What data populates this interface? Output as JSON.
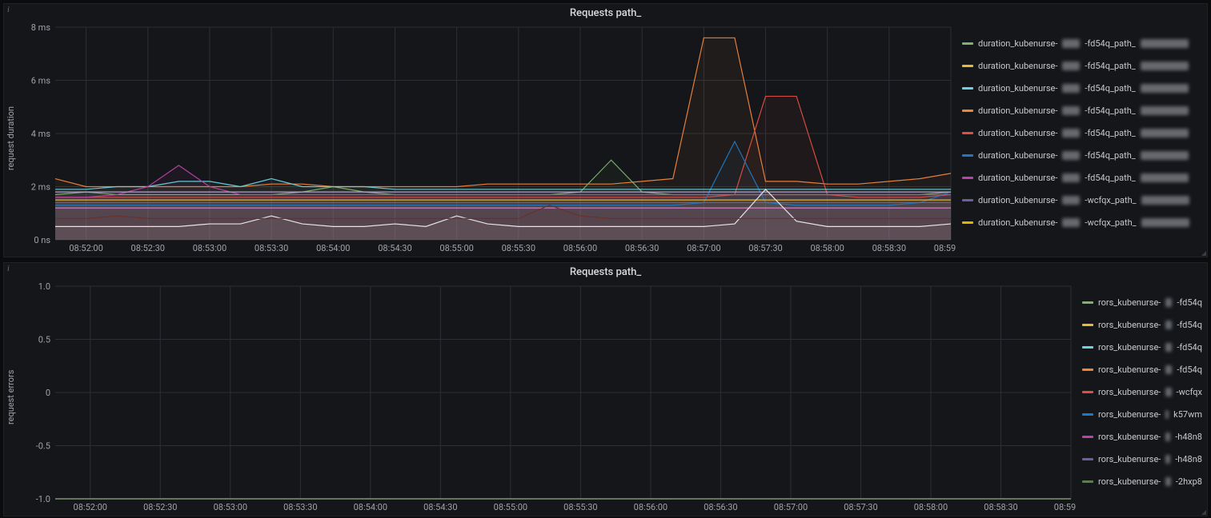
{
  "panel1": {
    "title": "Requests path_",
    "ylabel": "request duration",
    "legend_prefix": "duration_kubenurse-",
    "legend_suffix": "-fd54q_path_",
    "legend_rows": [
      {
        "color": "#7EB26D",
        "mid": "-fd54q_path_"
      },
      {
        "color": "#EAB839",
        "mid": "-fd54q_path_"
      },
      {
        "color": "#6ED0E0",
        "mid": "-fd54q_path_"
      },
      {
        "color": "#EF843C",
        "mid": "-fd54q_path_"
      },
      {
        "color": "#E24D42",
        "mid": "-fd54q_path_"
      },
      {
        "color": "#1F78C1",
        "mid": "-fd54q_path_"
      },
      {
        "color": "#BA43A9",
        "mid": "-fd54q_path_"
      },
      {
        "color": "#705DA0",
        "mid": "-wcfqx_path_"
      },
      {
        "color": "#E0B400",
        "mid": "-wcfqx_path_"
      }
    ]
  },
  "panel2": {
    "title": "Requests path_",
    "ylabel": "request errors",
    "legend_prefix": "rors_kubenurse-",
    "legend_rows": [
      {
        "color": "#7EB26D",
        "mid": "-fd54q"
      },
      {
        "color": "#EAB839",
        "mid": "-fd54q"
      },
      {
        "color": "#6ED0E0",
        "mid": "-fd54q"
      },
      {
        "color": "#EF843C",
        "mid": "-fd54q"
      },
      {
        "color": "#E24D42",
        "mid": "-wcfqx"
      },
      {
        "color": "#1F78C1",
        "mid": "k57wm"
      },
      {
        "color": "#BA43A9",
        "mid": "-h48n8"
      },
      {
        "color": "#705DA0",
        "mid": "-h48n8"
      },
      {
        "color": "#508642",
        "mid": "-2hxp8"
      }
    ]
  },
  "chart_data": [
    {
      "type": "line",
      "title": "Requests path_",
      "xlabel": "",
      "ylabel": "request duration",
      "ylim": [
        0,
        8
      ],
      "y_unit": "ms",
      "y_ticks": [
        "0 ns",
        "2 ms",
        "4 ms",
        "6 ms",
        "8 ms"
      ],
      "x_ticks": [
        "08:52:00",
        "08:52:30",
        "08:53:00",
        "08:53:30",
        "08:54:00",
        "08:54:30",
        "08:55:00",
        "08:55:30",
        "08:56:00",
        "08:56:30",
        "08:57:00",
        "08:57:30",
        "08:58:00",
        "08:58:30",
        "08:59:00"
      ],
      "x": [
        0,
        1,
        2,
        3,
        4,
        5,
        6,
        7,
        8,
        9,
        10,
        11,
        12,
        13,
        14,
        15,
        16,
        17,
        18,
        19,
        20,
        21,
        22,
        23,
        24,
        25,
        26,
        27,
        28,
        29
      ],
      "note": "x indices are 15s-interval samples spanning 08:51:45–08:59:15; values in ms, approximated from gridlines",
      "series": [
        {
          "name": "duration_kubenurse-…-fd54q_path_ (orange spike)",
          "color": "#EF843C",
          "values": [
            2.3,
            2.0,
            2.0,
            2.0,
            2.0,
            2.0,
            2.0,
            2.1,
            2.1,
            2.0,
            2.0,
            2.0,
            2.0,
            2.0,
            2.1,
            2.1,
            2.1,
            2.1,
            2.1,
            2.2,
            2.3,
            7.6,
            7.6,
            2.2,
            2.2,
            2.1,
            2.1,
            2.2,
            2.3,
            2.5
          ]
        },
        {
          "name": "duration_kubenurse-…-fd54q_path_ (red spike)",
          "color": "#E24D42",
          "values": [
            1.6,
            1.6,
            1.6,
            1.6,
            1.6,
            1.6,
            1.6,
            1.6,
            1.6,
            1.6,
            1.6,
            1.6,
            1.6,
            1.6,
            1.6,
            1.6,
            1.6,
            1.6,
            1.6,
            1.6,
            1.6,
            1.6,
            1.7,
            5.4,
            5.4,
            1.7,
            1.6,
            1.6,
            1.6,
            1.7
          ]
        },
        {
          "name": "duration_kubenurse-…-fd54q_path_ (green bump)",
          "color": "#7EB26D",
          "values": [
            1.7,
            1.8,
            1.7,
            1.7,
            1.7,
            1.7,
            1.7,
            1.7,
            1.8,
            2.0,
            1.8,
            1.7,
            1.7,
            1.7,
            1.7,
            1.7,
            1.7,
            1.8,
            3.0,
            1.8,
            1.7,
            1.7,
            1.7,
            1.7,
            1.7,
            1.7,
            1.7,
            1.7,
            1.7,
            1.8
          ]
        },
        {
          "name": "duration_kubenurse-…-fd54q_path_ (blue bump)",
          "color": "#1F78C1",
          "values": [
            1.3,
            1.3,
            1.3,
            1.3,
            1.3,
            1.3,
            1.3,
            1.3,
            1.3,
            1.3,
            1.3,
            1.3,
            1.3,
            1.3,
            1.3,
            1.3,
            1.3,
            1.3,
            1.3,
            1.3,
            1.3,
            1.4,
            3.7,
            1.4,
            1.3,
            1.3,
            1.3,
            1.3,
            1.4,
            1.8
          ]
        },
        {
          "name": "duration_kubenurse-…-fd54q_path_ (cyan)",
          "color": "#6ED0E0",
          "values": [
            1.9,
            1.9,
            2.0,
            2.0,
            2.2,
            2.2,
            2.0,
            2.3,
            2.0,
            2.0,
            2.0,
            1.9,
            1.9,
            1.9,
            1.9,
            1.9,
            1.9,
            1.9,
            1.9,
            1.9,
            1.9,
            1.9,
            1.9,
            1.9,
            1.9,
            1.9,
            1.9,
            1.9,
            1.9,
            1.9
          ]
        },
        {
          "name": "duration_kubenurse-…-fd54q_path_ (magenta)",
          "color": "#BA43A9",
          "values": [
            1.6,
            1.6,
            1.7,
            2.0,
            2.8,
            2.0,
            1.7,
            1.7,
            1.7,
            1.7,
            1.7,
            1.7,
            1.7,
            1.7,
            1.7,
            1.7,
            1.7,
            1.7,
            1.7,
            1.7,
            1.7,
            1.7,
            1.7,
            1.7,
            1.7,
            1.7,
            1.7,
            1.7,
            1.7,
            1.7
          ]
        },
        {
          "name": "duration_kubenurse-…-fd54q_path_ (yellow)",
          "color": "#EAB839",
          "values": [
            1.5,
            1.5,
            1.5,
            1.5,
            1.5,
            1.5,
            1.5,
            1.5,
            1.5,
            1.5,
            1.5,
            1.5,
            1.5,
            1.5,
            1.5,
            1.5,
            1.5,
            1.5,
            1.5,
            1.5,
            1.5,
            1.5,
            1.5,
            1.5,
            1.5,
            1.5,
            1.5,
            1.5,
            1.5,
            1.5
          ]
        },
        {
          "name": "duration_kubenurse-…-wcfqx_path_ (violet)",
          "color": "#705DA0",
          "values": [
            1.4,
            1.4,
            1.4,
            1.4,
            1.4,
            1.4,
            1.4,
            1.4,
            1.4,
            1.4,
            1.4,
            1.4,
            1.4,
            1.4,
            1.4,
            1.4,
            1.4,
            1.4,
            1.4,
            1.4,
            1.4,
            1.4,
            1.4,
            1.4,
            1.4,
            1.4,
            1.4,
            1.4,
            1.4,
            1.4
          ]
        },
        {
          "name": "duration_kubenurse-… (pink)",
          "color": "#d683ce",
          "values": [
            1.2,
            1.2,
            1.2,
            1.2,
            1.2,
            1.2,
            1.2,
            1.2,
            1.2,
            1.2,
            1.2,
            1.2,
            1.2,
            1.2,
            1.2,
            1.2,
            1.2,
            1.2,
            1.2,
            1.2,
            1.2,
            1.2,
            1.2,
            1.2,
            1.2,
            1.2,
            1.2,
            1.2,
            1.2,
            1.2
          ]
        },
        {
          "name": "duration_kubenurse-… (lavender)",
          "color": "#b7a8d6",
          "values": [
            1.8,
            1.8,
            1.8,
            1.8,
            1.8,
            1.8,
            1.8,
            1.8,
            1.8,
            1.8,
            1.8,
            1.8,
            1.8,
            1.8,
            1.8,
            1.8,
            1.8,
            1.8,
            1.8,
            1.8,
            1.8,
            1.8,
            1.8,
            1.8,
            1.8,
            1.8,
            1.8,
            1.8,
            1.8,
            1.8
          ]
        },
        {
          "name": "duration_kubenurse-… (white)",
          "color": "#eeeeee",
          "values": [
            0.5,
            0.5,
            0.5,
            0.5,
            0.5,
            0.6,
            0.6,
            0.9,
            0.6,
            0.5,
            0.5,
            0.6,
            0.5,
            0.9,
            0.6,
            0.5,
            0.5,
            0.5,
            0.5,
            0.5,
            0.5,
            0.5,
            0.6,
            1.9,
            0.7,
            0.5,
            0.5,
            0.5,
            0.5,
            0.6
          ]
        },
        {
          "name": "duration_kubenurse-… (dark red)",
          "color": "#6b2f2b",
          "values": [
            0.8,
            0.8,
            0.9,
            0.8,
            0.8,
            0.8,
            0.8,
            0.8,
            0.8,
            0.8,
            0.8,
            0.8,
            0.8,
            0.8,
            0.8,
            0.8,
            1.3,
            0.9,
            0.8,
            0.8,
            0.8,
            0.8,
            0.8,
            0.8,
            0.8,
            0.8,
            0.8,
            0.8,
            0.8,
            0.8
          ]
        }
      ]
    },
    {
      "type": "line",
      "title": "Requests path_",
      "xlabel": "",
      "ylabel": "request errors",
      "ylim": [
        -1.0,
        1.0
      ],
      "y_ticks": [
        "-1.0",
        "-0.5",
        "0",
        "0.5",
        "1.0"
      ],
      "x_ticks": [
        "08:52:00",
        "08:52:30",
        "08:53:00",
        "08:53:30",
        "08:54:00",
        "08:54:30",
        "08:55:00",
        "08:55:30",
        "08:56:00",
        "08:56:30",
        "08:57:00",
        "08:57:30",
        "08:58:00",
        "08:58:30",
        "08:59:00"
      ],
      "note": "All visible error series are flat near -1.0",
      "series": [
        {
          "name": "rors_kubenurse-…-fd54q",
          "color": "#7EB26D",
          "constant_value": -1.0
        },
        {
          "name": "rors_kubenurse-…-fd54q",
          "color": "#EAB839",
          "constant_value": -1.0
        },
        {
          "name": "rors_kubenurse-…-fd54q",
          "color": "#6ED0E0",
          "constant_value": -1.0
        },
        {
          "name": "rors_kubenurse-…-fd54q",
          "color": "#EF843C",
          "constant_value": -1.0
        },
        {
          "name": "rors_kubenurse-…-wcfqx",
          "color": "#E24D42",
          "constant_value": -1.0
        },
        {
          "name": "rors_kubenurse-…k57wm",
          "color": "#1F78C1",
          "constant_value": -1.0
        },
        {
          "name": "rors_kubenurse-…-h48n8",
          "color": "#BA43A9",
          "constant_value": -1.0
        },
        {
          "name": "rors_kubenurse-…-h48n8",
          "color": "#705DA0",
          "constant_value": -1.0
        },
        {
          "name": "rors_kubenurse-…-2hxp8",
          "color": "#508642",
          "constant_value": -1.0
        }
      ]
    }
  ]
}
